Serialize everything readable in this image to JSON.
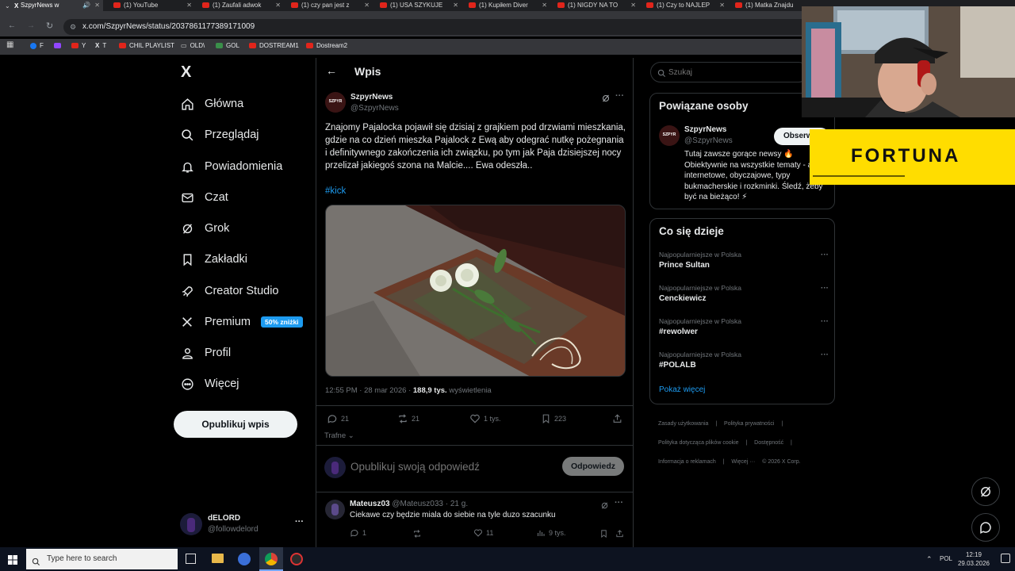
{
  "browser": {
    "tabs": [
      {
        "label": "SzpyrNews w"
      },
      {
        "label": "(1) YouTube"
      },
      {
        "label": "(1) Zaufali adwok"
      },
      {
        "label": "(1) czy pan jest z"
      },
      {
        "label": "(1) USA SZYKUJE"
      },
      {
        "label": "(1) Kupiłem Diver"
      },
      {
        "label": "(1) NIGDY NA TO"
      },
      {
        "label": "(1) Czy to NAJLEP"
      },
      {
        "label": "(1) Matka Znajdu"
      }
    ],
    "url": "x.com/SzpyrNews/status/2037861177389171009",
    "bookmarks": [
      {
        "label": "F"
      },
      {
        "label": ""
      },
      {
        "label": "Y"
      },
      {
        "label": "T"
      },
      {
        "label": "CHIL PLAYLIST"
      },
      {
        "label": "OLD\\"
      },
      {
        "label": "GOL"
      },
      {
        "label": "DOSTREAM1"
      },
      {
        "label": "Dostream2"
      }
    ]
  },
  "nav": {
    "logo": "X",
    "items": [
      {
        "label": "Główna",
        "icon": "home-icon"
      },
      {
        "label": "Przeglądaj",
        "icon": "search-icon"
      },
      {
        "label": "Powiadomienia",
        "icon": "bell-icon"
      },
      {
        "label": "Czat",
        "icon": "mail-icon"
      },
      {
        "label": "Grok",
        "icon": "grok-icon"
      },
      {
        "label": "Zakładki",
        "icon": "bookmark-icon"
      },
      {
        "label": "Creator Studio",
        "icon": "rocket-icon"
      },
      {
        "label": "Premium",
        "icon": "x-icon"
      },
      {
        "label": "Profil",
        "icon": "person-icon"
      },
      {
        "label": "Więcej",
        "icon": "more-circle-icon"
      }
    ],
    "premium_badge": "50% zniżki",
    "post_button": "Opublikuj wpis",
    "account": {
      "name": "dELORD",
      "handle": "@followdelord",
      "more": "···"
    }
  },
  "main": {
    "header_title": "Wpis",
    "post": {
      "author": "SzpyrNews",
      "handle": "@SzpyrNews",
      "avatar_text": "SZPYR",
      "text": "Znajomy Pajalocka pojawił się dzisiaj z grajkiem pod drzwiami mieszkania, gdzie na co dzień mieszka Pajalock z Ewą aby odegrać nutkę pożegnania i definitywnego zakończenia ich związku, po tym jak Paja dzisiejszej nocy przelizał jakiegoś szona na Malcie.... Ewa odeszła..",
      "hashtag": "#kick",
      "timestamp": "12:55 PM · 28 mar 2026 · ",
      "views_count": "188,9 tys.",
      "views_label": " wyświetlenia",
      "replies": "21",
      "reposts": "21",
      "likes": "1 tys.",
      "bookmarks": "223",
      "sort_label": "Trafne"
    },
    "reply_box": {
      "placeholder": "Opublikuj swoją odpowiedź",
      "button": "Odpowiedz"
    },
    "reply": {
      "author": "Mateusz03",
      "meta": "@Mateusz033 · 21 g.",
      "text": "Ciekawe czy będzie miala do siebie na tyle duzo szacunku",
      "replies": "1",
      "likes": "11",
      "views": "9 tys."
    }
  },
  "right": {
    "search_placeholder": "Szukaj",
    "related_title": "Powiązane osoby",
    "related": {
      "name": "SzpyrNews",
      "handle": "@SzpyrNews",
      "follow": "Obserw",
      "bio": "Tutaj zawsze gorące newsy 🔥 Obiektywnie na wszystkie tematy - afery internetowe, obyczajowe, typy bukmacherskie i rozkminki. Śledź, żeby być na bieżąco! ⚡"
    },
    "trends_title": "Co się dzieje",
    "trends": [
      {
        "meta": "Najpopularniejsze w Polska",
        "name": "Prince Sultan"
      },
      {
        "meta": "Najpopularniejsze w Polska",
        "name": "Cenckiewicz"
      },
      {
        "meta": "Najpopularniejsze w Polska",
        "name": "#rewolwer"
      },
      {
        "meta": "Najpopularniejsze w Polska",
        "name": "#POLALB"
      }
    ],
    "show_more": "Pokaż więcej",
    "footer": {
      "line1": [
        "Zasady użytkowania",
        "|",
        "Polityka prywatności",
        "|"
      ],
      "line2": [
        "Polityka dotycząca plików cookie",
        "|",
        "Dostępność",
        "|"
      ],
      "line3": [
        "Informacja o reklamach",
        "|",
        "Więcej ···",
        "© 2026 X Corp."
      ]
    }
  },
  "overlay": {
    "sponsor": "FORTUNA",
    "sponsor_color": "#ffdd00"
  },
  "taskbar": {
    "search_placeholder": "Type here to search",
    "lang": "POL",
    "time": "12:19",
    "date": "29.03.2026"
  }
}
